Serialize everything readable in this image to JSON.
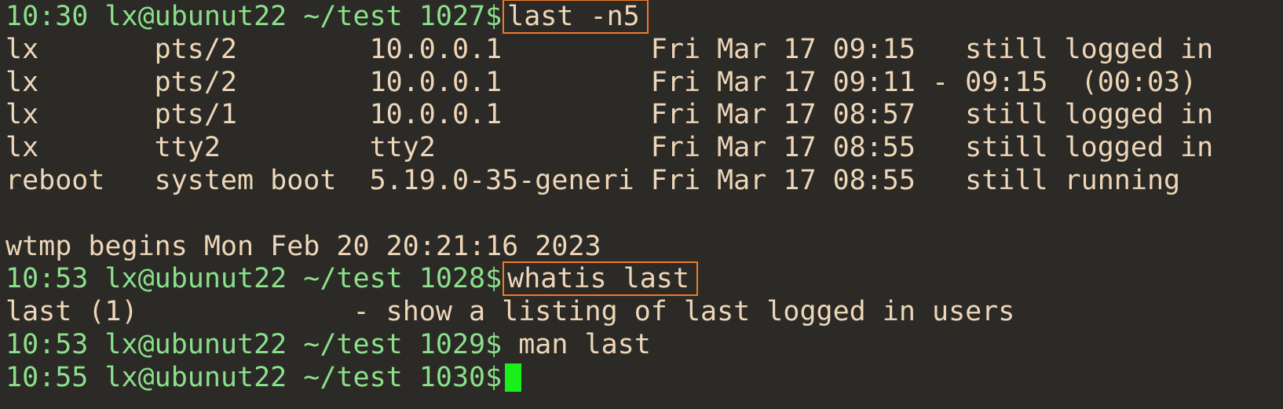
{
  "terminal": {
    "block1": {
      "prompt": "10:30 lx@ubunut22 ~/test 1027$",
      "command": "last -n5",
      "rows": [
        "lx       pts/2        10.0.0.1         Fri Mar 17 09:15   still logged in",
        "lx       pts/2        10.0.0.1         Fri Mar 17 09:11 - 09:15  (00:03)",
        "lx       pts/1        10.0.0.1         Fri Mar 17 08:57   still logged in",
        "lx       tty2         tty2             Fri Mar 17 08:55   still logged in",
        "reboot   system boot  5.19.0-35-generi Fri Mar 17 08:55   still running"
      ],
      "blank": "",
      "footer": "wtmp begins Mon Feb 20 20:21:16 2023"
    },
    "block2": {
      "prompt": "10:53 lx@ubunut22 ~/test 1028$",
      "command": "whatis last",
      "output": "last (1)             - show a listing of last logged in users"
    },
    "block3": {
      "prompt": "10:53 lx@ubunut22 ~/test 1029$",
      "command": "man last"
    },
    "block4": {
      "prompt": "10:55 lx@ubunut22 ~/test 1030$"
    },
    "colors": {
      "background": "#2b2a26",
      "prompt": "#8be08b",
      "text": "#efd6b8",
      "highlight_box": "#f07a28",
      "cursor": "#19f019"
    }
  }
}
